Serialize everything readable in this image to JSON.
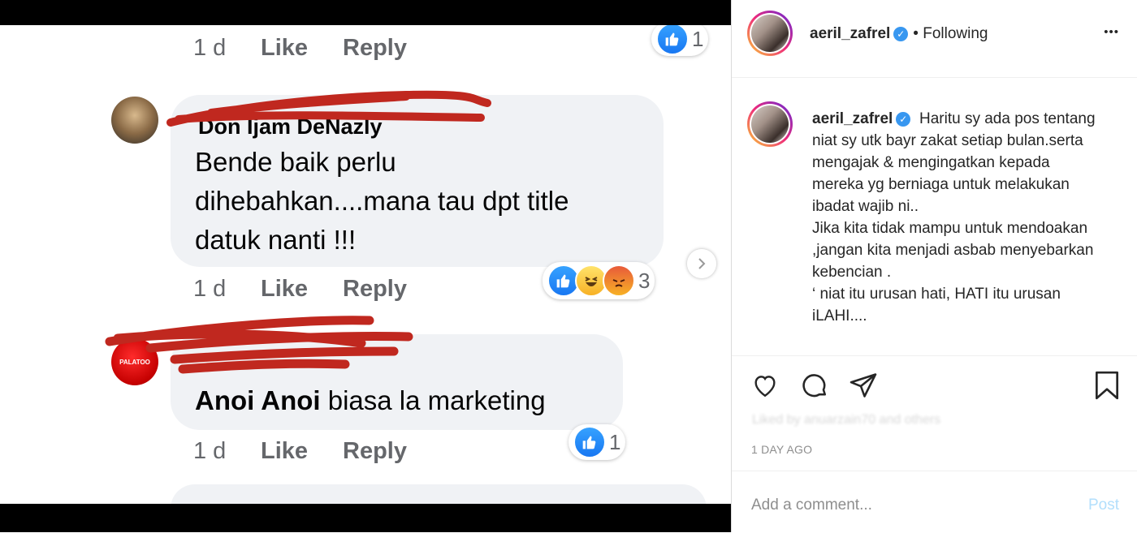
{
  "fb": {
    "top_row": {
      "time": "1 d",
      "like": "Like",
      "reply": "Reply",
      "count": "1"
    },
    "comment1": {
      "name": "Don Ijam DeNazly",
      "lines": [
        "Bende baik perlu",
        "dihebahkan....mana tau dpt title",
        "datuk nanti !!!"
      ],
      "time": "1 d",
      "like": "Like",
      "reply": "Reply",
      "reaction_count": "3"
    },
    "comment2": {
      "avatar_text": "PALATOO",
      "name": "Anoi Anoi",
      "text": "biasa la marketing",
      "time": "1 d",
      "like": "Like",
      "reply": "Reply",
      "count": "1"
    }
  },
  "ig": {
    "username": "aeril_zafrel",
    "follow_status": "• Following",
    "more": "•••",
    "caption": "Haritu sy ada pos tentang niat sy utk bayr zakat setiap bulan.serta mengajak & mengingatkan kepada mereka yg berniaga untuk melakukan ibadat wajib ni..\nJika kita tidak mampu untuk mendoakan ,jangan kita menjadi asbab menyebarkan kebencian .\n‘ niat itu urusan hati, HATI itu urusan iLAHI....",
    "liked_by": "Liked by anuarzain70 and others",
    "date": "1 DAY AGO",
    "comment_placeholder": "Add a comment...",
    "post_label": "Post"
  },
  "colors": {
    "accent": "#3897f0",
    "post_disabled": "#b2dffc",
    "scribble": "#c0281f"
  }
}
